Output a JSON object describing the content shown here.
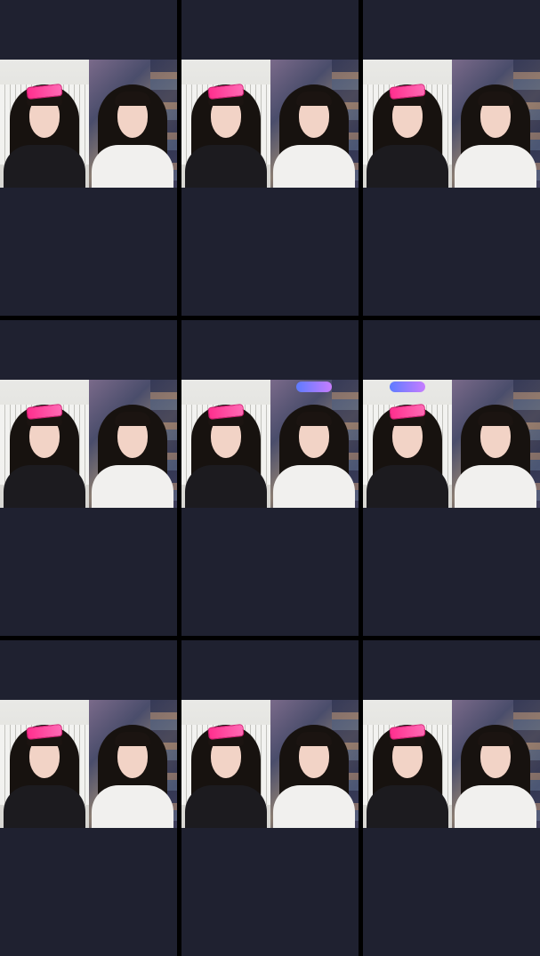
{
  "cells": [
    {
      "clip": true,
      "badge": false
    },
    {
      "clip": true,
      "badge": false
    },
    {
      "clip": true,
      "badge": false
    },
    {
      "clip": true,
      "badge": false
    },
    {
      "clip": true,
      "badge": true
    },
    {
      "clip": true,
      "badge": true
    },
    {
      "clip": true,
      "badge": false
    },
    {
      "clip": true,
      "badge": false
    },
    {
      "clip": true,
      "badge": false
    }
  ],
  "colors": {
    "page_background": "#000000",
    "cell_background": "#1f2130",
    "accent_clip": "#ff2f8e"
  }
}
